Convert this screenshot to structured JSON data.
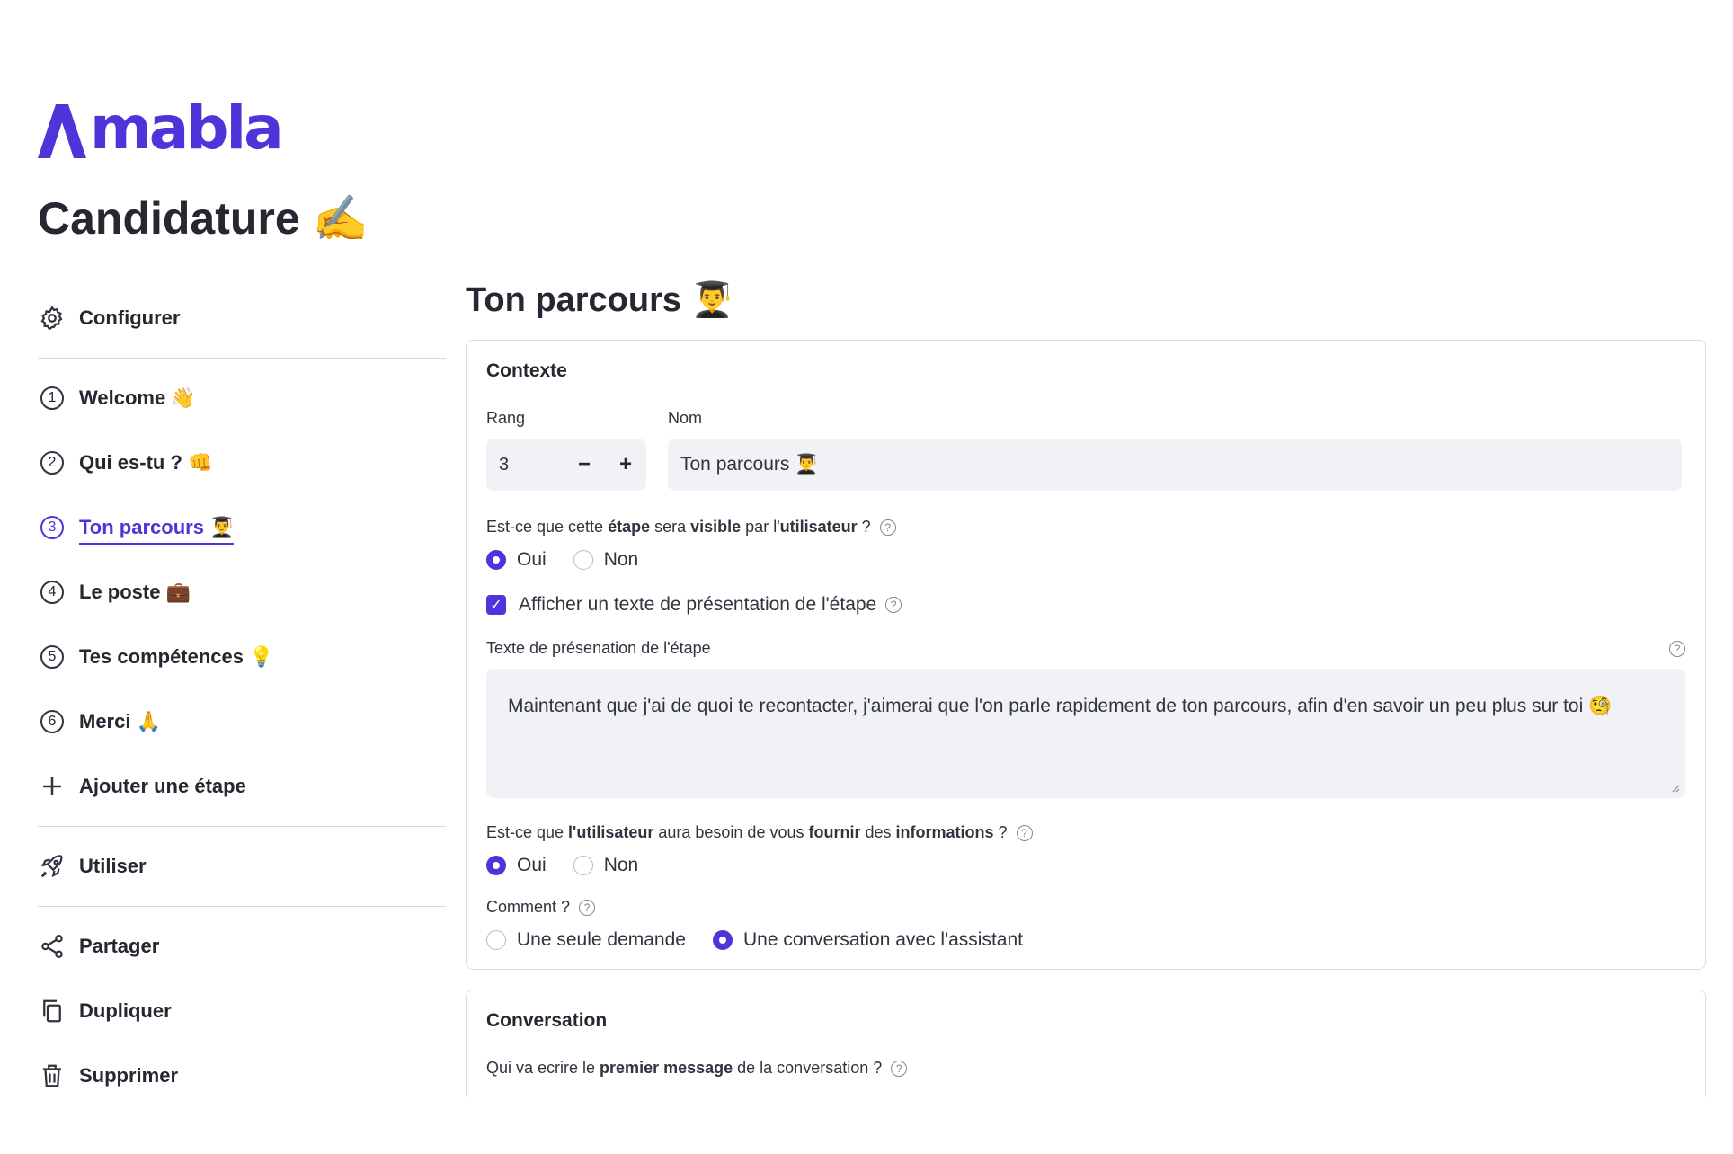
{
  "brand": {
    "name": "mabla",
    "color": "#4f35d9"
  },
  "app_title": "Candidature ✍️",
  "sidebar": {
    "configure": {
      "label": "Configurer",
      "icon": "gear-icon"
    },
    "steps": [
      {
        "num": "1",
        "label": "Welcome 👋"
      },
      {
        "num": "2",
        "label": "Qui es-tu ? 👊"
      },
      {
        "num": "3",
        "label": "Ton parcours 👨‍🎓",
        "active": true
      },
      {
        "num": "4",
        "label": "Le poste 💼"
      },
      {
        "num": "5",
        "label": "Tes compétences 💡"
      },
      {
        "num": "6",
        "label": "Merci 🙏"
      }
    ],
    "add_step": {
      "label": "Ajouter une étape",
      "icon": "plus-icon"
    },
    "use": {
      "label": "Utiliser",
      "icon": "rocket-icon"
    },
    "share": {
      "label": "Partager",
      "icon": "share-icon"
    },
    "duplicate": {
      "label": "Dupliquer",
      "icon": "copy-icon"
    },
    "delete": {
      "label": "Supprimer",
      "icon": "trash-icon"
    }
  },
  "main": {
    "title": "Ton parcours 👨‍🎓",
    "context": {
      "title": "Contexte",
      "rank_label": "Rang",
      "rank_value": "3",
      "minus": "−",
      "plus": "+",
      "name_label": "Nom",
      "name_value": "Ton parcours 👨‍🎓",
      "visible_q": {
        "p1": "Est-ce que cette ",
        "b1": "étape",
        "p2": " sera ",
        "b2": "visible",
        "p3": " par l'",
        "b3": "utilisateur",
        "p4": " ?"
      },
      "visible_options": {
        "yes": "Oui",
        "no": "Non",
        "selected": "Oui"
      },
      "show_text_label": "Afficher un texte de présentation de l'étape",
      "show_text_checked": true,
      "text_label": "Texte de présenation de l'étape",
      "text_value": "Maintenant que j'ai de quoi te recontacter, j'aimerai que l'on parle rapidement de ton parcours, afin d'en savoir un peu plus sur toi 🧐",
      "info_q": {
        "p1": "Est-ce que ",
        "b1": "l'utilisateur",
        "p2": " aura besoin de vous ",
        "b2": "fournir",
        "p3": " des ",
        "b3": "informations",
        "p4": " ?"
      },
      "info_options": {
        "yes": "Oui",
        "no": "Non",
        "selected": "Oui"
      },
      "how_label": "Comment ?",
      "how_options": {
        "single": "Une seule demande",
        "conversation": "Une conversation avec l'assistant",
        "selected": "Une conversation avec l'assistant"
      }
    },
    "conversation": {
      "title": "Conversation",
      "first_q": {
        "p1": "Qui va ecrire le ",
        "b1": "premier message",
        "p2": " de la conversation ?"
      }
    }
  }
}
